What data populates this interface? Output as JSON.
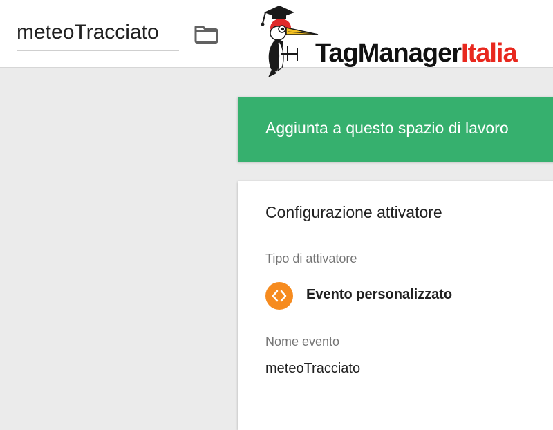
{
  "header": {
    "title": "meteoTracciato",
    "folder_icon": "folder-icon",
    "logo": {
      "text_part1": "TagManager",
      "text_part2": "Italia",
      "color_part1": "#111111",
      "color_part2": "#e8281e",
      "mascot_icon": "woodpecker-graduate-icon"
    }
  },
  "banner": {
    "text": "Aggiunta a questo spazio di lavoro",
    "color": "#36b06e"
  },
  "trigger_config": {
    "title": "Configurazione attivatore",
    "type_label": "Tipo di attivatore",
    "type_icon": "code-brackets-icon",
    "type_icon_color": "#f68b1f",
    "type_value": "Evento personalizzato",
    "event_name_label": "Nome evento",
    "event_name_value": "meteoTracciato"
  }
}
